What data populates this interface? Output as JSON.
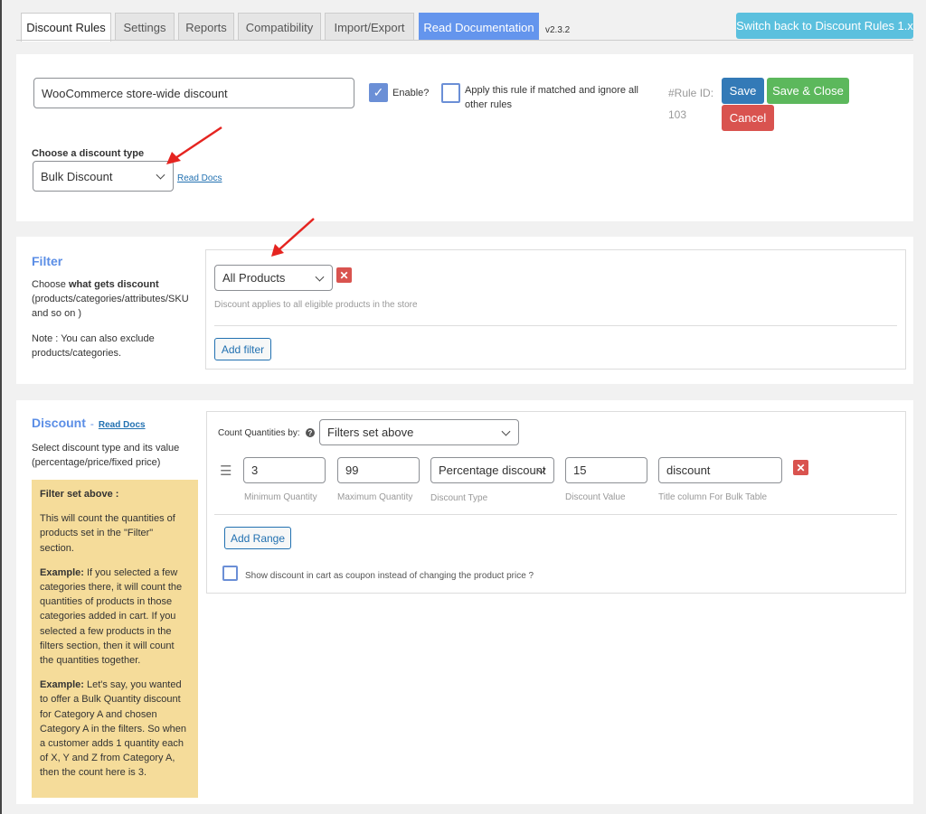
{
  "tabs": [
    {
      "label": "Discount Rules"
    },
    {
      "label": "Settings"
    },
    {
      "label": "Reports"
    },
    {
      "label": "Compatibility"
    },
    {
      "label": "Import/Export"
    }
  ],
  "read_documentation": "Read Documentation",
  "version": "v2.3.2",
  "switch_back": "Switch back to Discount Rules 1.x",
  "rule": {
    "name_value": "WooCommerce store-wide discount",
    "enable_label": "Enable?",
    "enable_checked": true,
    "exclusive_label": "Apply this rule if matched and ignore all other rules",
    "exclusive_checked": false,
    "rule_id_label": "#Rule ID:",
    "rule_id": "103",
    "save": "Save",
    "save_close": "Save & Close",
    "cancel": "Cancel",
    "discount_type_label": "Choose a discount type",
    "discount_type_value": "Bulk Discount",
    "read_docs": "Read Docs"
  },
  "filter": {
    "title": "Filter",
    "desc_prefix": "Choose ",
    "desc_bold": "what gets discount",
    "desc_suffix": "(products/categories/attributes/SKU and so on )",
    "note": "Note : You can also exclude products/categories.",
    "select_value": "All Products",
    "help": "Discount applies to all eligible products in the store",
    "add_filter": "Add filter"
  },
  "discount": {
    "title": "Discount",
    "dash": "-",
    "read_docs": "Read Docs",
    "desc": "Select discount type and its value (percentage/price/fixed price)",
    "note_title": "Filter set above :",
    "note_p1": "This will count the quantities of products set in the \"Filter\" section.",
    "note_ex1_bold": "Example:",
    "note_ex1": " If you selected a few categories there, it will count the quantities of products in those categories added in cart. If you selected a few products in the filters section, then it will count the quantities together.",
    "note_ex2_bold": "Example:",
    "note_ex2": " Let's say, you wanted to offer a Bulk Quantity discount for Category A and chosen Category A in the filters. So when a customer adds 1 quantity each of X, Y and Z from Category A, then the count here is 3.",
    "count_by_label": "Count Quantities by:",
    "count_by_value": "Filters set above",
    "range": {
      "min": "3",
      "max": "99",
      "type": "Percentage discount",
      "value": "15",
      "title": "discount"
    },
    "labels": {
      "min": "Minimum Quantity",
      "max": "Maximum Quantity",
      "type": "Discount Type",
      "value": "Discount Value",
      "title": "Title column For Bulk Table"
    },
    "add_range": "Add Range",
    "coupon_label": "Show discount in cart as coupon instead of changing the product price ?",
    "coupon_checked": false
  },
  "colors": {
    "accent": "#5b8ee6",
    "save": "#337ab7",
    "save_close": "#5cb85c",
    "cancel": "#d9534f",
    "switch": "#5bc0de",
    "note_bg": "#f5dc9a"
  }
}
